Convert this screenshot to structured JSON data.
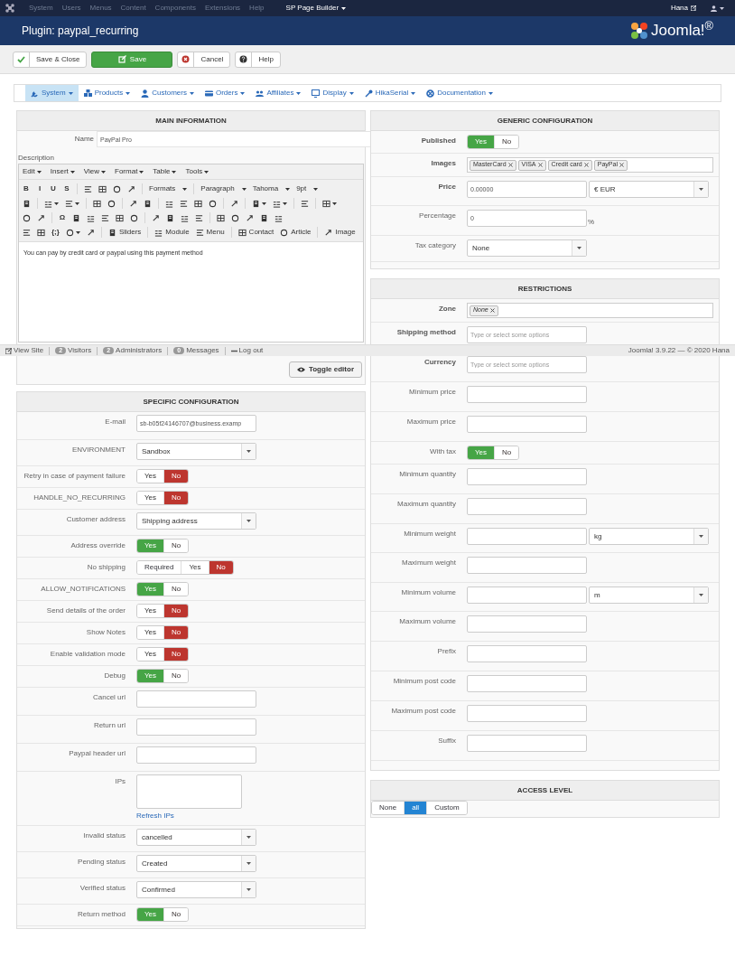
{
  "top_nav": {
    "items": [
      {
        "label": "System",
        "disabled": true
      },
      {
        "label": "Users",
        "disabled": true
      },
      {
        "label": "Menus",
        "disabled": true
      },
      {
        "label": "Content",
        "disabled": true
      },
      {
        "label": "Components",
        "disabled": true
      },
      {
        "label": "Extensions",
        "disabled": true
      },
      {
        "label": "Help",
        "disabled": true
      },
      {
        "label": "SP Page Builder",
        "disabled": false
      }
    ],
    "user": "Hana"
  },
  "header": {
    "title": "Plugin: paypal_recurring",
    "brand": "Joomla!$^{®}$"
  },
  "toolbar": [
    {
      "label": "Save & Close",
      "kind": "default"
    },
    {
      "label": "Save",
      "kind": "success"
    },
    {
      "label": "Cancel",
      "kind": "default"
    },
    {
      "label": "Help",
      "kind": "default"
    }
  ],
  "submenu": [
    {
      "label": "System",
      "selected": true
    },
    {
      "label": "Products",
      "selected": false
    },
    {
      "label": "Customers",
      "selected": false
    },
    {
      "label": "Orders",
      "selected": false
    },
    {
      "label": "Affiliates",
      "selected": false
    },
    {
      "label": "Display",
      "selected": false
    },
    {
      "label": "HikaSerial",
      "selected": false
    },
    {
      "label": "Documentation",
      "selected": false
    }
  ],
  "main_information": {
    "title": "MAIN INFORMATION",
    "name_label": "Name",
    "name_value": "PayPal Pro",
    "description_label": "Description",
    "editor": {
      "menus": [
        "Edit",
        "Insert",
        "View",
        "Format",
        "Table",
        "Tools"
      ],
      "toolbar_rows": [
        [
          {
            "kind": "glyph",
            "text": "B"
          },
          {
            "kind": "glyph",
            "text": "I"
          },
          {
            "kind": "glyph",
            "text": "U"
          },
          {
            "kind": "glyph",
            "text": "S"
          },
          {
            "kind": "sep"
          },
          {
            "kind": "icon"
          },
          {
            "kind": "icon"
          },
          {
            "kind": "icon"
          },
          {
            "kind": "icon"
          },
          {
            "kind": "sep"
          },
          {
            "kind": "dropdown",
            "text": "Formats"
          },
          {
            "kind": "sep"
          },
          {
            "kind": "dropdown",
            "text": "Paragraph"
          },
          {
            "kind": "dropdown",
            "text": "Tahoma"
          },
          {
            "kind": "dropdown",
            "text": "9pt"
          }
        ],
        [
          {
            "kind": "icon"
          },
          {
            "kind": "sep"
          },
          {
            "kind": "icon_menu"
          },
          {
            "kind": "icon_menu"
          },
          {
            "kind": "sep"
          },
          {
            "kind": "icon"
          },
          {
            "kind": "icon"
          },
          {
            "kind": "sep"
          },
          {
            "kind": "icon"
          },
          {
            "kind": "icon"
          },
          {
            "kind": "sep"
          },
          {
            "kind": "icon"
          },
          {
            "kind": "icon"
          },
          {
            "kind": "icon"
          },
          {
            "kind": "icon"
          },
          {
            "kind": "sep"
          },
          {
            "kind": "icon"
          },
          {
            "kind": "sep"
          },
          {
            "kind": "icon_menu"
          },
          {
            "kind": "icon_menu"
          },
          {
            "kind": "sep"
          },
          {
            "kind": "icon"
          },
          {
            "kind": "sep"
          },
          {
            "kind": "icon_menu"
          }
        ],
        [
          {
            "kind": "icon"
          },
          {
            "kind": "icon"
          },
          {
            "kind": "sep"
          },
          {
            "kind": "glyph",
            "text": "Ω"
          },
          {
            "kind": "icon"
          },
          {
            "kind": "icon"
          },
          {
            "kind": "icon"
          },
          {
            "kind": "icon"
          },
          {
            "kind": "icon"
          },
          {
            "kind": "sep"
          },
          {
            "kind": "icon"
          },
          {
            "kind": "icon"
          },
          {
            "kind": "icon"
          },
          {
            "kind": "icon"
          },
          {
            "kind": "sep"
          },
          {
            "kind": "icon"
          },
          {
            "kind": "icon"
          },
          {
            "kind": "icon"
          },
          {
            "kind": "icon"
          },
          {
            "kind": "icon"
          }
        ],
        [
          {
            "kind": "icon"
          },
          {
            "kind": "icon"
          },
          {
            "kind": "glyph",
            "text": "{;}"
          },
          {
            "kind": "icon_menu"
          },
          {
            "kind": "icon"
          },
          {
            "kind": "sep"
          },
          {
            "kind": "button",
            "text": "Sliders"
          },
          {
            "kind": "sep"
          },
          {
            "kind": "button",
            "text": "Module"
          },
          {
            "kind": "button",
            "text": "Menu"
          },
          {
            "kind": "sep"
          },
          {
            "kind": "button",
            "text": "Contact"
          },
          {
            "kind": "button",
            "text": "Article"
          },
          {
            "kind": "sep"
          },
          {
            "kind": "button",
            "text": "Image"
          }
        ]
      ],
      "content": "You can pay by credit card or paypal using this payment method"
    },
    "toggle_button": "Toggle editor"
  },
  "status_bar": {
    "items": [
      {
        "label": "View Site"
      },
      {
        "count": "2",
        "label": "Visitors"
      },
      {
        "count": "2",
        "label": "Administrators"
      },
      {
        "count": "0",
        "label": "Messages"
      },
      {
        "label": "Log out"
      }
    ],
    "version": "Joomla! 3.9.22 — © 2020 Hana"
  },
  "specific_configuration": {
    "title": "SPECIFIC CONFIGURATION",
    "fields": [
      {
        "label": "E-mail",
        "kind": "text",
        "value": "sb-b05f24146707@business.examp"
      },
      {
        "label": "ENVIRONMENT",
        "kind": "select",
        "value": "Sandbox"
      },
      {
        "label": "Retry in case of payment failure",
        "kind": "toggle",
        "options": [
          {
            "label": "Yes",
            "kind": "positive",
            "selected": false
          },
          {
            "label": "No",
            "kind": "negative",
            "selected": true
          }
        ]
      },
      {
        "label": "HANDLE_NO_RECURRING",
        "kind": "toggle",
        "options": [
          {
            "label": "Yes",
            "kind": "positive",
            "selected": false
          },
          {
            "label": "No",
            "kind": "negative",
            "selected": true
          }
        ]
      },
      {
        "label": "Customer address",
        "kind": "select",
        "value": "Shipping address"
      },
      {
        "label": "Address override",
        "kind": "toggle",
        "options": [
          {
            "label": "Yes",
            "kind": "positive",
            "selected": true
          },
          {
            "label": "No",
            "kind": "negative",
            "selected": false
          }
        ]
      },
      {
        "label": "No shipping",
        "kind": "toggle",
        "options": [
          {
            "label": "Required",
            "kind": "neutral",
            "selected": false
          },
          {
            "label": "Yes",
            "kind": "positive",
            "selected": false
          },
          {
            "label": "No",
            "kind": "negative",
            "selected": true
          }
        ]
      },
      {
        "label": "ALLOW_NOTIFICATIONS",
        "kind": "toggle",
        "options": [
          {
            "label": "Yes",
            "kind": "positive",
            "selected": true
          },
          {
            "label": "No",
            "kind": "negative",
            "selected": false
          }
        ]
      },
      {
        "label": "Send details of the order",
        "kind": "toggle",
        "options": [
          {
            "label": "Yes",
            "kind": "positive",
            "selected": false
          },
          {
            "label": "No",
            "kind": "negative",
            "selected": true
          }
        ]
      },
      {
        "label": "Show Notes",
        "kind": "toggle",
        "options": [
          {
            "label": "Yes",
            "kind": "positive",
            "selected": false
          },
          {
            "label": "No",
            "kind": "negative",
            "selected": true
          }
        ]
      },
      {
        "label": "Enable validation mode",
        "kind": "toggle",
        "options": [
          {
            "label": "Yes",
            "kind": "positive",
            "selected": false
          },
          {
            "label": "No",
            "kind": "negative",
            "selected": true
          }
        ]
      },
      {
        "label": "Debug",
        "kind": "toggle",
        "options": [
          {
            "label": "Yes",
            "kind": "positive",
            "selected": true
          },
          {
            "label": "No",
            "kind": "negative",
            "selected": false
          }
        ]
      },
      {
        "label": "Cancel url",
        "kind": "text"
      },
      {
        "label": "Return url",
        "kind": "text"
      },
      {
        "label": "Paypal header url",
        "kind": "text"
      },
      {
        "label": "IPs",
        "kind": "textarea",
        "link": "Refresh IPs"
      },
      {
        "label": "Invalid status",
        "kind": "select",
        "value": "cancelled"
      },
      {
        "label": "Pending status",
        "kind": "select",
        "value": "Created"
      },
      {
        "label": "Verified status",
        "kind": "select",
        "value": "Confirmed"
      },
      {
        "label": "Return method",
        "kind": "toggle",
        "options": [
          {
            "label": "Yes",
            "kind": "positive",
            "selected": true
          },
          {
            "label": "No",
            "kind": "negative",
            "selected": false
          }
        ]
      }
    ]
  },
  "generic_configuration": {
    "title": "GENERIC CONFIGURATION",
    "fields": [
      {
        "label": "Published",
        "bold": true,
        "kind": "toggle",
        "options": [
          {
            "label": "Yes",
            "kind": "positive",
            "selected": true
          },
          {
            "label": "No",
            "kind": "negative",
            "selected": false
          }
        ]
      },
      {
        "label": "Images",
        "bold": true,
        "kind": "tags",
        "tags": [
          {
            "text": "MasterCard",
            "italic": false
          },
          {
            "text": "VISA",
            "italic": false
          },
          {
            "text": "Credit card",
            "italic": false
          },
          {
            "text": "PayPal",
            "italic": false
          }
        ]
      },
      {
        "label": "Price",
        "bold": true,
        "kind": "text_select",
        "value": "0.00000",
        "unit": "€ EUR"
      },
      {
        "label": "Percentage",
        "bold": false,
        "kind": "text",
        "value": "0",
        "suffix": "%"
      },
      {
        "label": "Tax category",
        "bold": false,
        "kind": "select",
        "value": "None"
      }
    ]
  },
  "restrictions": {
    "title": "RESTRICTIONS",
    "fields": [
      {
        "label": "Zone",
        "bold": true,
        "kind": "tags",
        "tags": [
          {
            "text": "None",
            "italic": true
          }
        ]
      },
      {
        "label": "Shipping method",
        "bold": true,
        "kind": "text",
        "placeholder": "Type or select some options"
      },
      {
        "label": "Currency",
        "bold": true,
        "kind": "text",
        "placeholder": "Type or select some options"
      },
      {
        "label": "Minimum price",
        "bold": false,
        "kind": "text"
      },
      {
        "label": "Maximum price",
        "bold": false,
        "kind": "text"
      },
      {
        "label": "With tax",
        "bold": false,
        "kind": "toggle",
        "options": [
          {
            "label": "Yes",
            "kind": "positive",
            "selected": true
          },
          {
            "label": "No",
            "kind": "negative",
            "selected": false
          }
        ]
      },
      {
        "label": "Minimum quantity",
        "bold": false,
        "kind": "text"
      },
      {
        "label": "Maximum quantity",
        "bold": false,
        "kind": "text"
      },
      {
        "label": "Minimum weight",
        "bold": false,
        "kind": "text_select",
        "unit": "kg"
      },
      {
        "label": "Maximum weight",
        "bold": false,
        "kind": "text"
      },
      {
        "label": "Minimum volume",
        "bold": false,
        "kind": "text_select",
        "unit": "m"
      },
      {
        "label": "Maximum volume",
        "bold": false,
        "kind": "text"
      },
      {
        "label": "Prefix",
        "bold": false,
        "kind": "text"
      },
      {
        "label": "Minimum post code",
        "bold": false,
        "kind": "text"
      },
      {
        "label": "Maximum post code",
        "bold": false,
        "kind": "text"
      },
      {
        "label": "Suffix",
        "bold": false,
        "kind": "text"
      }
    ]
  },
  "access_level": {
    "title": "ACCESS LEVEL",
    "options": [
      {
        "label": "None",
        "kind": "neutral",
        "selected": false
      },
      {
        "label": "all",
        "kind": "neutral",
        "selected": true
      },
      {
        "label": "Custom",
        "kind": "neutral",
        "selected": false
      }
    ]
  }
}
